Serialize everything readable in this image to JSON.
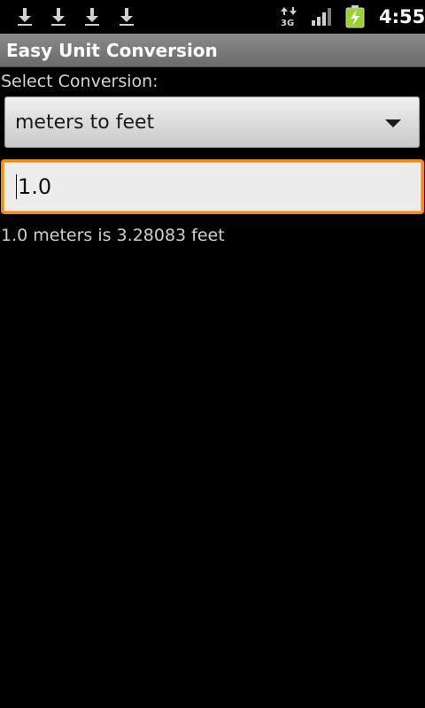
{
  "status_bar": {
    "time": "4:55",
    "icons": [
      "download-icon",
      "download-icon",
      "download-icon",
      "download-icon",
      "3g-data-icon",
      "signal-strength-icon",
      "battery-charging-icon"
    ],
    "network_label": "3G"
  },
  "app": {
    "title": "Easy Unit Conversion"
  },
  "form": {
    "select_label": "Select Conversion:",
    "conversion_selected": "meters to feet",
    "input_value": "1.0",
    "result": "1.0 meters is 3.28083 feet"
  },
  "colors": {
    "focus_border": "#f08c14",
    "title_bar": "#7a7a7a",
    "background": "#000000"
  }
}
